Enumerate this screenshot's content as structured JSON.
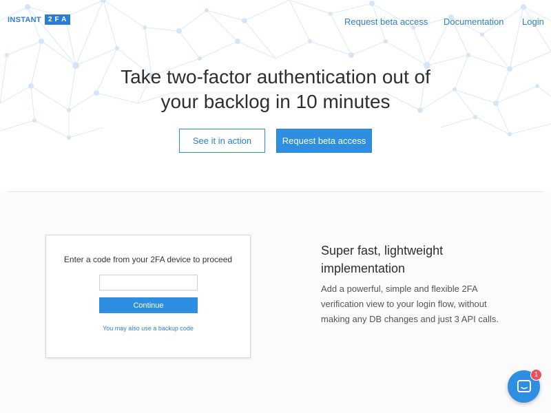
{
  "brand": {
    "logo_word": "INSTANT",
    "logo_box": "2FA",
    "accent_color": "#2a7fd4"
  },
  "nav": {
    "items": [
      {
        "label": "Request beta access"
      },
      {
        "label": "Documentation"
      },
      {
        "label": "Login"
      }
    ]
  },
  "hero": {
    "headline_line1": "Take two-factor authentication out of",
    "headline_line2": "your backlog in 10 minutes",
    "secondary_button": "See it in action",
    "primary_button": "Request beta access"
  },
  "demo_card": {
    "title": "Enter a code from your 2FA device to proceed",
    "input_value": "",
    "continue_label": "Continue",
    "backup_link": "You may also use a backup code"
  },
  "feature": {
    "title": "Super fast, lightweight implementation",
    "text": "Add a powerful, simple and flexible 2FA verification view to your login flow, without making any DB changes and just 3 API calls."
  },
  "chat": {
    "icon": "chat-bubble-icon",
    "badge_count": "1",
    "badge_color": "#ee4e5e"
  }
}
